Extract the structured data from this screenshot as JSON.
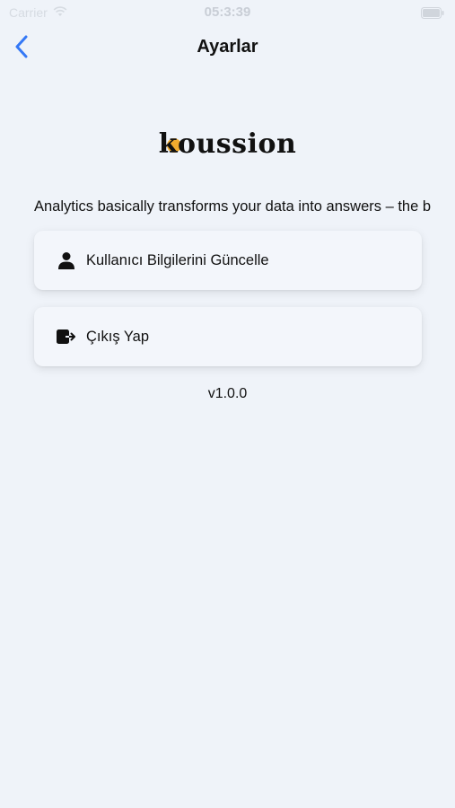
{
  "status_bar": {
    "carrier": "Carrier",
    "time": "05:3:39",
    "wifi_icon": "wifi-icon",
    "battery_icon": "battery-icon"
  },
  "nav": {
    "title": "Ayarlar",
    "back_icon": "chevron-left-icon",
    "accent_color": "#3478f6"
  },
  "logo": {
    "text": "koussion",
    "accent_color": "#f0a623"
  },
  "description": "Analytics basically transforms your data into answers – the b",
  "menu": [
    {
      "label": "Kullanıcı Bilgilerini Güncelle",
      "icon": "person-icon"
    },
    {
      "label": "Çıkış Yap",
      "icon": "logout-icon"
    }
  ],
  "version": "v1.0.0"
}
